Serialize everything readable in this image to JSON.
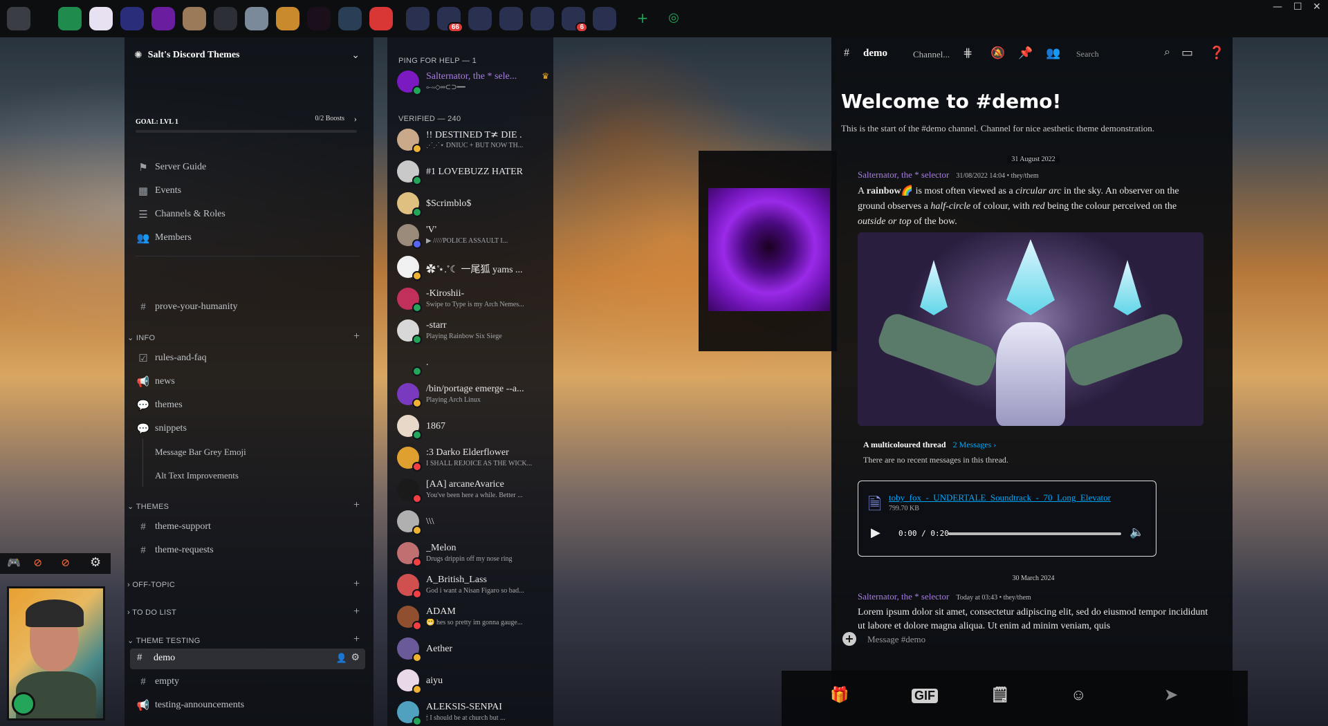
{
  "window": {
    "minimize": "—",
    "maximize": "☐",
    "close": "✕"
  },
  "topbar": {
    "servers": [
      {
        "icon": "discord-logo-icon",
        "color": "#3a3d44"
      },
      {
        "icon": "folder-icon",
        "color": "#1f8b4c"
      },
      {
        "icon": "r-server-icon",
        "color": "#e8e1f2"
      },
      {
        "icon": "g-server-icon",
        "color": "#2a2d7a"
      },
      {
        "icon": "r-purple-server-icon",
        "color": "#6b1da0"
      },
      {
        "icon": "cat-server-icon",
        "color": "#9a7a58"
      },
      {
        "icon": "code-server-icon",
        "color": "#2c2f35"
      },
      {
        "icon": "rainbow-server-icon",
        "color": "#7a8a9a"
      },
      {
        "icon": "geometric-server-icon",
        "color": "#c98a2e"
      },
      {
        "icon": "eyes-server-icon",
        "color": "#1a0f1a"
      },
      {
        "icon": "astronaut-server-icon",
        "color": "#2a3e55"
      },
      {
        "icon": "flask-server-icon",
        "color": "#d93636"
      }
    ],
    "folders": [
      {
        "icon": "server-folder-icon",
        "badge": ""
      },
      {
        "icon": "server-folder-icon",
        "badge": "66"
      },
      {
        "icon": "server-folder-icon",
        "badge": ""
      },
      {
        "icon": "server-folder-icon",
        "badge": ""
      },
      {
        "icon": "server-folder-icon",
        "badge": ""
      },
      {
        "icon": "server-folder-icon",
        "badge": "6"
      },
      {
        "icon": "server-folder-icon",
        "badge": ""
      }
    ],
    "add_server": "+",
    "discover": "◎"
  },
  "sidebar": {
    "server_name": "Salt's Discord Themes",
    "goal_label": "GOAL: LVL 1",
    "boosts": "0/2 Boosts",
    "nav": [
      {
        "label": "Server Guide",
        "icon": "signpost-icon"
      },
      {
        "label": "Events",
        "icon": "calendar-icon"
      },
      {
        "label": "Channels & Roles",
        "icon": "list-icon"
      },
      {
        "label": "Members",
        "icon": "members-icon"
      }
    ],
    "prove": "prove-your-humanity",
    "cat_info": "INFO",
    "info_channels": [
      "rules-and-faq",
      "news",
      "themes",
      "snippets"
    ],
    "threads": [
      "Message Bar Grey Emoji",
      "Alt Text Improvements"
    ],
    "cat_themes": "THEMES",
    "theme_channels": [
      "theme-support",
      "theme-requests"
    ],
    "cat_offtopic": "OFF-TOPIC",
    "cat_todo": "TO DO LIST",
    "cat_testing": "THEME TESTING",
    "testing_channels": [
      "demo",
      "empty",
      "testing-announcements"
    ]
  },
  "members": {
    "ping_header": "PING FOR HELP — 1",
    "ping_member": {
      "name": "Salternator, the * sele...",
      "status": "⟜∾◇═⊂⊃━━"
    },
    "verified_header": "VERIFIED — 240",
    "list": [
      {
        "name": "!! DESTINED T≭ DIE .",
        "status": "⋰⋰⋆ DNIUC + BUT NOW TH...",
        "color": "#caa88a",
        "dot": "#f0b232"
      },
      {
        "name": "#1 LOVEBUZZ HATER",
        "status": "",
        "color": "#c9c9c9",
        "dot": "#23a55a"
      },
      {
        "name": "$Scrimblo$",
        "status": "",
        "color": "#e0c080",
        "dot": "#23a55a"
      },
      {
        "name": "'V'",
        "status": "▶ /////POLICE ASSAULT I...",
        "color": "#9a8a7a",
        "dot": "#5865f2"
      },
      {
        "name": "✿ ̊⋆.˚☾ 一尾狐 yams ...",
        "status": "",
        "color": "#f0f0f0",
        "dot": "#f0b232"
      },
      {
        "name": "-Kiroshii-",
        "status": "Swipe to Type is my Arch Nemes...",
        "color": "#c0305a",
        "dot": "#23a55a"
      },
      {
        "name": "-starr",
        "status": "Playing Rainbow Six Siege",
        "color": "#d8d8d8",
        "dot": "#23a55a"
      },
      {
        "name": ".",
        "status": "",
        "color": "transparent",
        "dot": "#23a55a"
      },
      {
        "name": "/bin/portage emerge --a...",
        "status": "Playing Arch Linux",
        "color": "#7a3ac0",
        "dot": "#f0b232"
      },
      {
        "name": "1867",
        "status": "",
        "color": "#e8d8c8",
        "dot": "#23a55a"
      },
      {
        "name": ":3 Darko Elderflower",
        "status": "I SHALL REJOICE AS THE WICK...",
        "color": "#e0a030",
        "dot": "#f23f43"
      },
      {
        "name": "[AA] arcaneAvarice",
        "status": "You've been here a while. Better ...",
        "color": "#1a1a1a",
        "dot": "#f23f43"
      },
      {
        "name": "\\\\\\",
        "status": "",
        "color": "#b0b0b0",
        "dot": "#f0b232"
      },
      {
        "name": "_Melon",
        "status": "Drugs drippin off my nose ring",
        "color": "#c07070",
        "dot": "#f23f43"
      },
      {
        "name": "A_British_Lass",
        "status": "God i want a Nisan Figaro so bad...",
        "color": "#d05050",
        "dot": "#f23f43"
      },
      {
        "name": "ADAM",
        "status": "😁 hes so pretty im gonna gauge...",
        "color": "#905030",
        "dot": "#f23f43"
      },
      {
        "name": "Aether",
        "status": "",
        "color": "#6a5a9a",
        "dot": "#f0b232"
      },
      {
        "name": "aiyu",
        "status": "",
        "color": "#e8d8e8",
        "dot": "#f0b232"
      },
      {
        "name": "ALEKSIS-SENPAI",
        "status": "🕯 I should be at church but ...",
        "color": "#50a0c0",
        "dot": "#23a55a"
      }
    ]
  },
  "chat": {
    "channel": "demo",
    "topic": "Channel...",
    "search_placeholder": "Search",
    "welcome_title": "Welcome to #demo!",
    "welcome_desc": "This is the start of the #demo channel. Channel for nice aesthetic theme demonstration.",
    "date1": "31 August 2022",
    "msg1": {
      "author": "Salternator, the * selector",
      "time": "31/08/2022 14:04 • they/them",
      "p1": "A ",
      "b1": "rainbow",
      "e1": "🌈",
      "p2": " is most often viewed as a ",
      "i1": "circular arc",
      "p3": " in the sky. An observer on the ground observes a ",
      "i2": "half-circle",
      "p4": " of colour, with ",
      "i3": "red",
      "p5": " being the colour perceived on the ",
      "i4": "outside or top",
      "p6": " of the bow."
    },
    "thread_name": "A multicoloured thread",
    "thread_count": "2 Messages ›",
    "thread_empty": "There are no recent messages in this thread.",
    "audio": {
      "name": "toby_fox_-_UNDERTALE_Soundtrack_-_70_Long_Elevator",
      "size": "799.70 KB",
      "time": "0:00 / 0:20",
      "progress": 0
    },
    "date2": "30 March 2024",
    "msg2": {
      "author": "Salternator, the * selector",
      "time": "Today at 03:43 • they/them",
      "text": "Lorem ipsum dolor sit amet, consectetur adipiscing elit, sed do eiusmod tempor incididunt ut labore et dolore magna aliqua. Ut enim ad minim veniam, quis"
    },
    "input_placeholder": "Message #demo",
    "gif_label": "GIF"
  },
  "colors": {
    "accent": "#a97de8",
    "link": "#00a8fc",
    "online": "#23a55a",
    "idle": "#f0b232",
    "dnd": "#f23f43"
  }
}
